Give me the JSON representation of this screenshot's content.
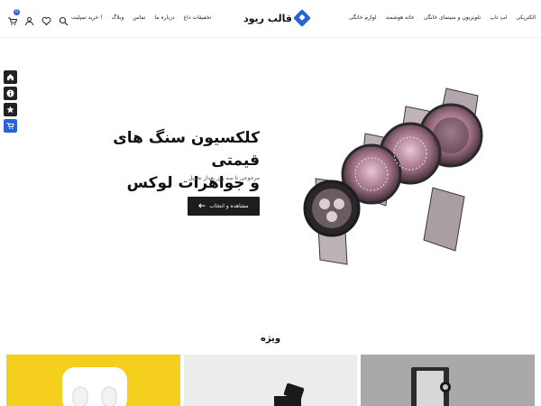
{
  "header": {
    "logo_text": "قالب ریود",
    "nav_right": [
      "الکتریکی",
      "لپ تاپ",
      "تلویزیون و سینمای خانگی",
      "خانه هوشمند",
      "لوازم خانگی"
    ],
    "nav_left": [
      "تخفیفات داغ",
      "درباره ما",
      "تماس",
      "وبلاگ",
      "خرید تمپلیت !"
    ],
    "cart_count": "0",
    "accent": "#2a62d8"
  },
  "icons": [
    "cart-icon",
    "user-icon",
    "heart-icon",
    "search-icon"
  ],
  "side_buttons": [
    "home-icon",
    "info-icon",
    "star-icon",
    "cart-icon"
  ],
  "hero": {
    "title_line1": "کلکسیون سنگ های قیمتی",
    "title_line2": "و جواهرات لوکس",
    "subtitle": "مرجوعی تا سه روز بعداز تحویل",
    "cta_label": "مشاهده و انتخاب"
  },
  "section": {
    "title": "ویژه"
  }
}
